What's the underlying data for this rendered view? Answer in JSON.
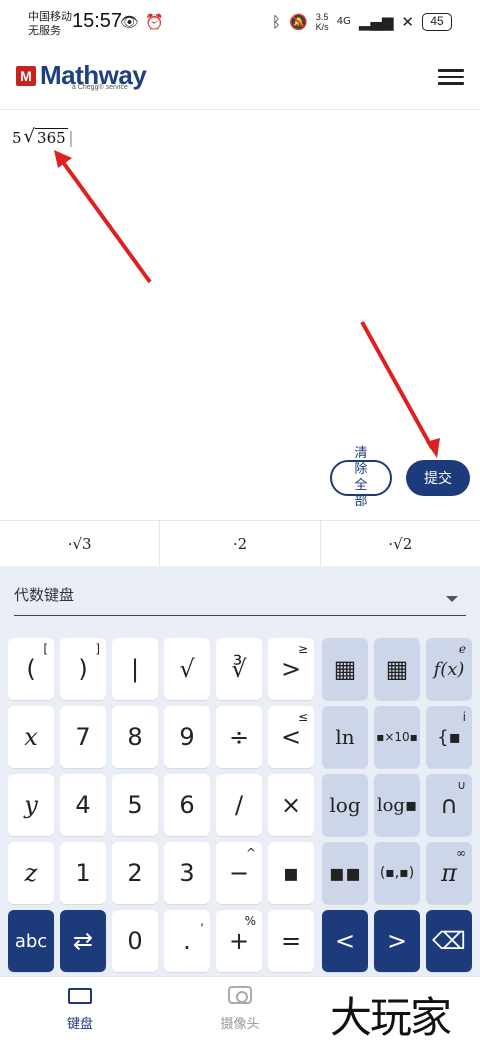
{
  "status_bar": {
    "carrier_line1": "中国移动",
    "carrier_line2": "无服务",
    "time": "15:57",
    "speed_top": "3.5",
    "speed_bottom": "K/s",
    "network": "4G",
    "battery": "45"
  },
  "header": {
    "logo_mark": "M",
    "logo_text": "Mathway",
    "logo_sub": "a Chegg® service"
  },
  "input": {
    "coefficient": "5",
    "sqrt_symbol": "√",
    "radicand": "365",
    "clear_label": "清除全部",
    "submit_label": "提交"
  },
  "suggestions": [
    "·√3",
    "·2",
    "·√2"
  ],
  "keyboard": {
    "selector_label": "代数键盘",
    "keys": {
      "row1": [
        "(",
        ")",
        "|",
        "√",
        "∛",
        ">"
      ],
      "row1_sup": [
        "[",
        "]",
        "",
        "",
        "",
        "≥"
      ],
      "row2": [
        "x",
        "7",
        "8",
        "9",
        "÷",
        "<"
      ],
      "row2_sup": [
        "",
        "",
        "",
        "",
        "",
        "≤"
      ],
      "row3": [
        "y",
        "4",
        "5",
        "6",
        "/",
        "×"
      ],
      "row4": [
        "z",
        "1",
        "2",
        "3",
        "−",
        "▪"
      ],
      "row4_sup": [
        "",
        "",
        "",
        "",
        "^",
        ""
      ],
      "row5": [
        "abc",
        "⇄",
        "0",
        ".",
        "+",
        "="
      ],
      "row5_sup": [
        "",
        "",
        "",
        ",",
        "%",
        ""
      ],
      "fn_col1": [
        "▦",
        "ln",
        "log",
        "▪▪",
        "<"
      ],
      "fn_col2": [
        "▦",
        "▪×10▪",
        "log▪",
        "(▪,▪)",
        ">"
      ],
      "fn_col3": [
        "f(x)",
        "{▪",
        "∩",
        "π",
        "⌫"
      ],
      "fn_col3_sup": [
        "e",
        "i",
        "∪",
        "∞",
        ""
      ]
    }
  },
  "bottom_nav": {
    "keyboard_label": "键盘",
    "camera_label": "摄像头"
  },
  "watermark": "大玩家"
}
